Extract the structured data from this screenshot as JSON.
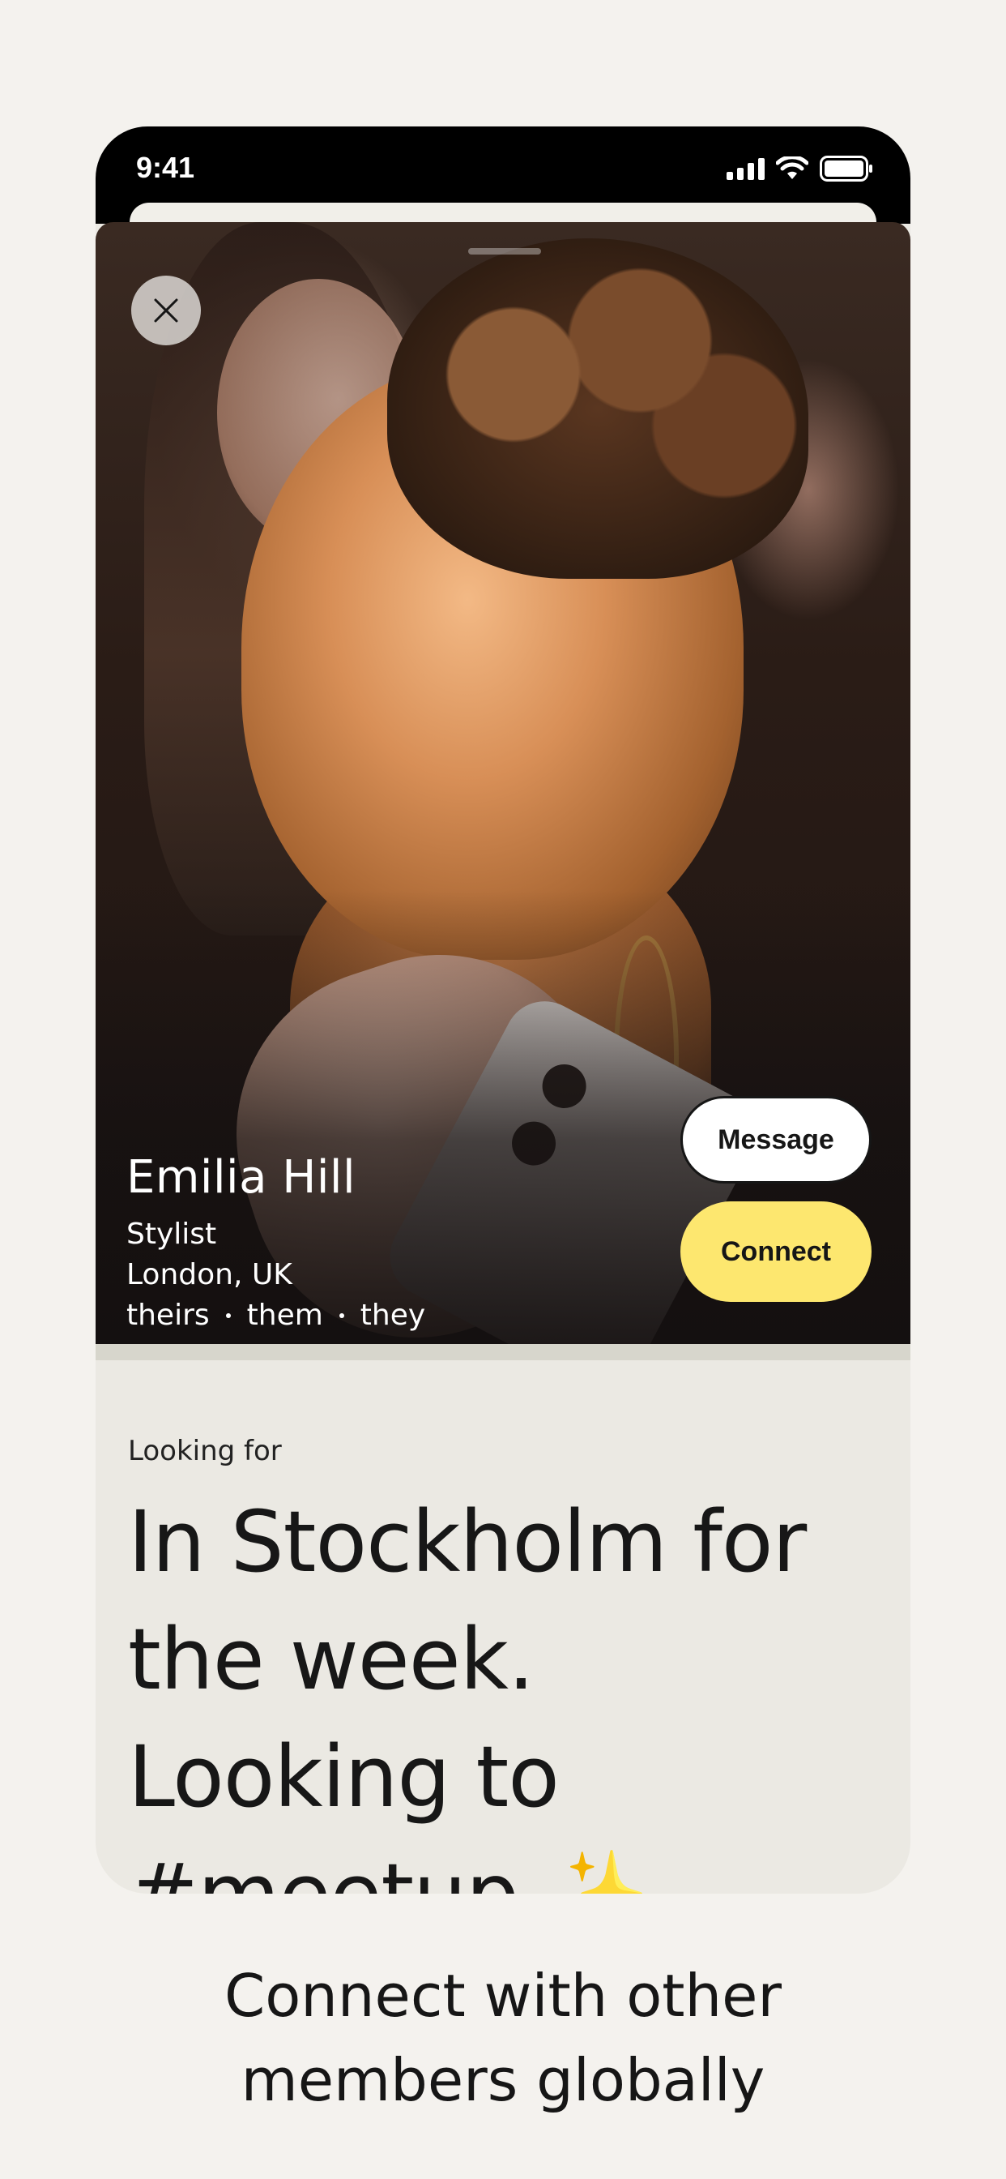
{
  "status_bar": {
    "time": "9:41"
  },
  "profile": {
    "name": "Emilia Hill",
    "occupation": "Stylist",
    "location": "London, UK",
    "pronouns": [
      "theirs",
      "them",
      "they"
    ]
  },
  "actions": {
    "message_label": "Message",
    "connect_label": "Connect"
  },
  "looking_for": {
    "label": "Looking for",
    "text": "In Stockholm for the week. Looking to #meetup",
    "emoji": "✨"
  },
  "caption": "Connect with other members globally",
  "colors": {
    "background": "#f4f2ee",
    "card_background": "#ebe9e3",
    "connect_button": "#fde76f",
    "message_button": "#ffffff"
  },
  "icons": {
    "close": "close-icon",
    "signal": "cellular-signal-icon",
    "wifi": "wifi-icon",
    "battery": "battery-icon"
  }
}
